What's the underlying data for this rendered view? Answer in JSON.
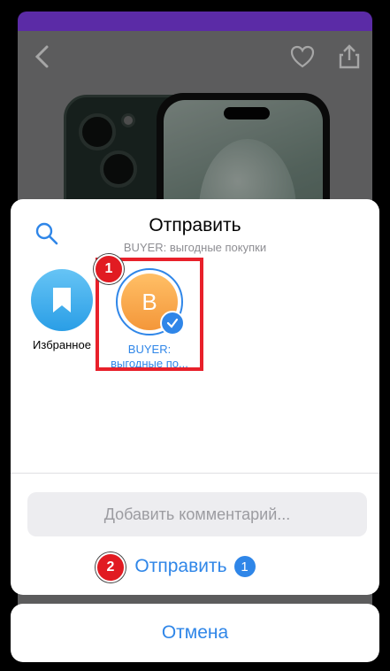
{
  "share_sheet": {
    "title": "Отправить",
    "subtitle": "BUYER: выгодные покупки",
    "targets": [
      {
        "label": "Избранное",
        "selected": false
      },
      {
        "label_line1": "BUYER:",
        "label_line2": "выгодные по...",
        "avatar_letter": "B",
        "selected": true
      }
    ],
    "comment_placeholder": "Добавить комментарий...",
    "send_label": "Отправить",
    "selected_count": "1",
    "cancel_label": "Отмена"
  },
  "annotations": {
    "step1": "1",
    "step2": "2"
  },
  "colors": {
    "accent": "#2f86e8",
    "highlight": "#e8202a",
    "header": "#5b2ba6"
  },
  "icons": [
    "back-chevron-icon",
    "heart-icon",
    "share-icon",
    "search-icon",
    "bookmark-icon",
    "checkmark-icon"
  ]
}
